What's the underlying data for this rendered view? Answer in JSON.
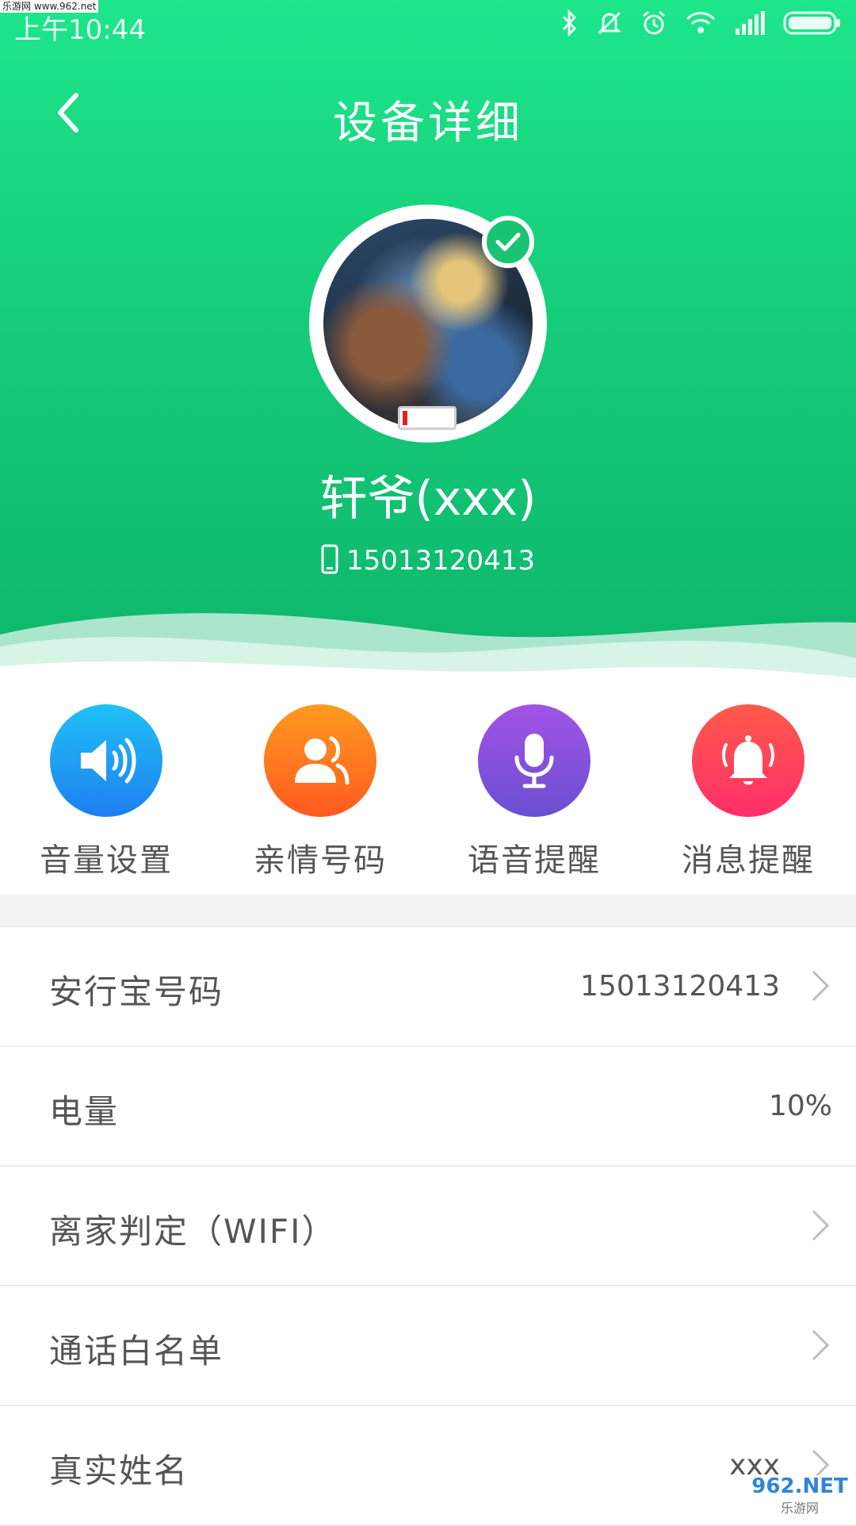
{
  "status_bar": {
    "time": "上午10:44",
    "watermark": "乐游网 www.962.net",
    "icons": [
      "bluetooth-icon",
      "mute-icon",
      "alarm-icon",
      "wifi-icon",
      "signal-icon",
      "battery-icon"
    ]
  },
  "header": {
    "title": "设备详细",
    "device_name": "轩爷(xxx)",
    "phone": "15013120413",
    "battery_level": 0.1
  },
  "features": [
    {
      "label": "音量设置",
      "icon": "speaker-icon",
      "color": "#1f8ff0"
    },
    {
      "label": "亲情号码",
      "icon": "contacts-icon",
      "color": "#ff6d1f"
    },
    {
      "label": "语音提醒",
      "icon": "microphone-icon",
      "color": "#8b4fd8"
    },
    {
      "label": "消息提醒",
      "icon": "bell-icon",
      "color": "#ff3d5e"
    }
  ],
  "rows": [
    {
      "label": "安行宝号码",
      "value": "15013120413",
      "arrow": true
    },
    {
      "label": "电量",
      "value": "10%",
      "arrow": false
    },
    {
      "label": "离家判定（WIFI）",
      "value": "",
      "arrow": true
    },
    {
      "label": "通话白名单",
      "value": "",
      "arrow": true
    },
    {
      "label": "真实姓名",
      "value": "xxx",
      "arrow": true
    }
  ],
  "footer_watermark": {
    "main": "962.NET",
    "sub": "乐游网"
  },
  "colors": {
    "header_green": "#1de68b",
    "accent_green": "#19c372"
  }
}
